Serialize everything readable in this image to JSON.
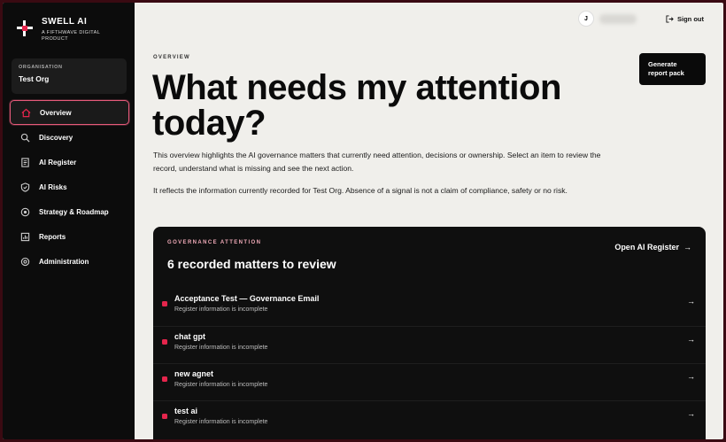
{
  "brand": {
    "name": "SWELL AI",
    "subtitle": "A FIFTHWAVE DIGITAL PRODUCT"
  },
  "organisation": {
    "label": "ORGANISATION",
    "name": "Test Org"
  },
  "nav": {
    "items": [
      {
        "label": "Overview",
        "icon": "home-icon",
        "active": true
      },
      {
        "label": "Discovery",
        "icon": "search-icon"
      },
      {
        "label": "AI Register",
        "icon": "document-icon"
      },
      {
        "label": "AI Risks",
        "icon": "shield-icon"
      },
      {
        "label": "Strategy & Roadmap",
        "icon": "target-icon"
      },
      {
        "label": "Reports",
        "icon": "report-icon"
      },
      {
        "label": "Administration",
        "icon": "gear-icon"
      }
    ]
  },
  "user": {
    "initial": "J",
    "signout_label": "Sign out"
  },
  "header": {
    "kicker": "OVERVIEW",
    "title": "What needs my attention today?",
    "generate_button": "Generate report pack"
  },
  "intro": {
    "paragraph1": "This overview highlights the AI governance matters that currently need attention, decisions or ownership. Select an item to review the record, understand what is missing and see the next action.",
    "paragraph2": "It reflects the information currently recorded for Test Org. Absence of a signal is not a claim of compliance, safety or no risk."
  },
  "attention": {
    "kicker": "GOVERNANCE ATTENTION",
    "title": "6 recorded matters to review",
    "link_label": "Open AI Register",
    "items": [
      {
        "title": "Acceptance Test — Governance Email",
        "subtitle": "Register information is incomplete"
      },
      {
        "title": "chat gpt",
        "subtitle": "Register information is incomplete"
      },
      {
        "title": "new agnet",
        "subtitle": "Register information is incomplete"
      },
      {
        "title": "test ai",
        "subtitle": "Register information is incomplete"
      }
    ]
  },
  "colors": {
    "accent": "#e5254c",
    "sidebar_bg": "#0c0c0c",
    "page_bg": "#f0efeb"
  }
}
